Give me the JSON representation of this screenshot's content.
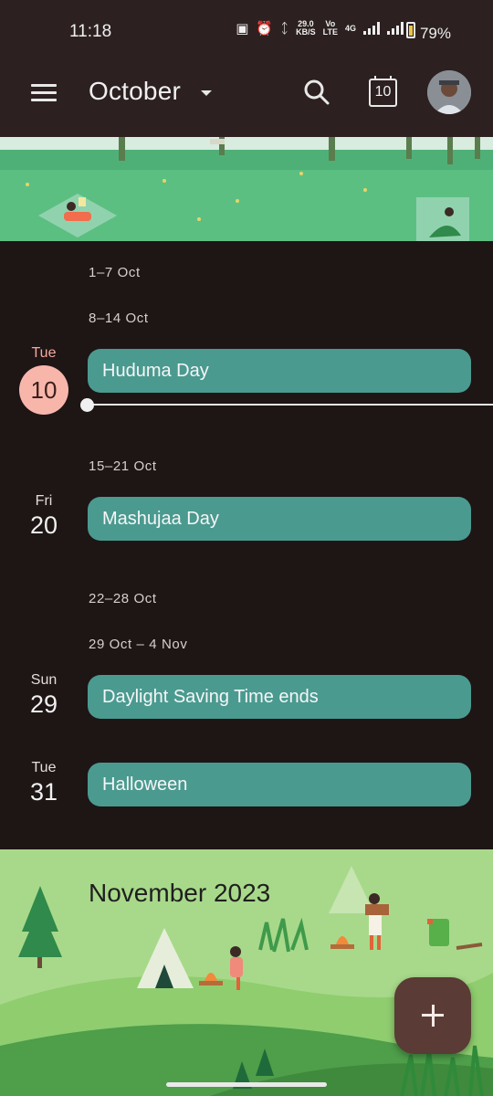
{
  "status_bar": {
    "time": "11:18",
    "speed_value": "29.0",
    "speed_unit": "KB/S",
    "network_top": "Vo",
    "network_bottom": "LTE",
    "network_type": "4G",
    "battery": "79%"
  },
  "app_bar": {
    "menu_icon": "hamburger-menu-icon",
    "month": "October",
    "today_number": "10"
  },
  "schedule": {
    "weeks": [
      {
        "label": "1–7 Oct"
      },
      {
        "label": "8–14 Oct"
      },
      {
        "label": "15–21 Oct"
      },
      {
        "label": "22–28 Oct"
      },
      {
        "label": "29 Oct – 4 Nov"
      }
    ],
    "days": [
      {
        "weekday": "Tue",
        "day": "10",
        "event": "Huduma Day",
        "today": true
      },
      {
        "weekday": "Fri",
        "day": "20",
        "event": "Mashujaa Day"
      },
      {
        "weekday": "Sun",
        "day": "29",
        "event": "Daylight Saving Time ends"
      },
      {
        "weekday": "Tue",
        "day": "31",
        "event": "Halloween"
      }
    ]
  },
  "next_month": {
    "title": "November 2023"
  },
  "colors": {
    "app_bar": "#2c2020",
    "background": "#1e1515",
    "event_chip": "#4a9a90",
    "today_circle": "#f8b6ab",
    "fab": "#5a3b35"
  }
}
